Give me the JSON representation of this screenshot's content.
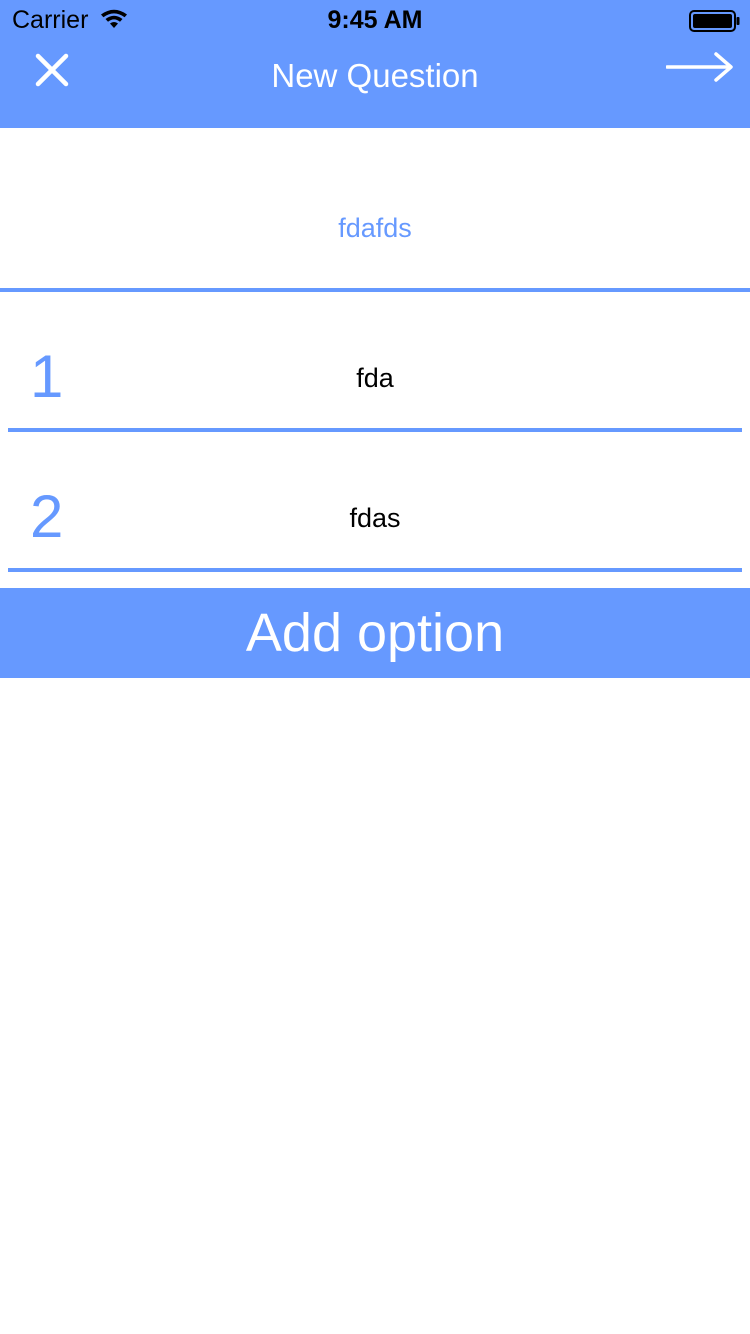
{
  "status_bar": {
    "carrier": "Carrier",
    "time": "9:45 AM",
    "wifi_icon": "wifi-icon",
    "battery_icon": "battery-icon"
  },
  "nav": {
    "title": "New Question",
    "close_icon": "close-icon",
    "next_icon": "arrow-right-icon"
  },
  "question": {
    "value": "fdafds"
  },
  "options": [
    {
      "number": "1",
      "text": "fda"
    },
    {
      "number": "2",
      "text": "fdas"
    }
  ],
  "add_option_label": "Add option",
  "colors": {
    "accent": "#6699FF",
    "background": "#FFFFFF",
    "text": "#000000"
  }
}
